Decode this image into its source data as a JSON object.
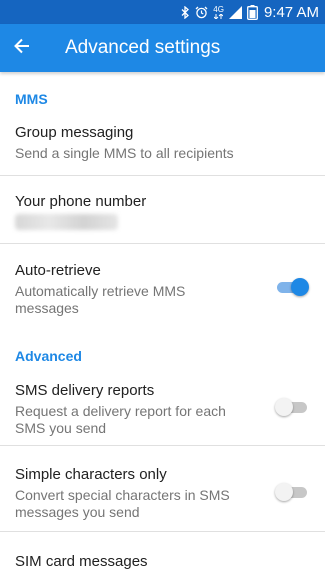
{
  "status_bar": {
    "time": "9:47 AM",
    "network": "4G",
    "icons": [
      "bluetooth-icon",
      "alarm-icon",
      "network-4g-icon",
      "signal-icon",
      "battery-icon"
    ]
  },
  "app_bar": {
    "title": "Advanced settings",
    "back_icon": "arrow-back-icon"
  },
  "sections": {
    "mms": {
      "header": "MMS",
      "group_messaging": {
        "title": "Group messaging",
        "summary": "Send a single MMS to all recipients"
      },
      "phone_number": {
        "title": "Your phone number"
      },
      "auto_retrieve": {
        "title": "Auto-retrieve",
        "summary_line1": "Automatically retrieve MMS",
        "summary_line2": "messages",
        "enabled": true
      }
    },
    "advanced": {
      "header": "Advanced",
      "delivery_reports": {
        "title": "SMS delivery reports",
        "summary_line1": "Request a delivery report for each",
        "summary_line2": "SMS you send",
        "enabled": false
      },
      "simple_chars": {
        "title": "Simple characters only",
        "summary_line1": "Convert special characters in SMS",
        "summary_line2": "messages you send",
        "enabled": false
      },
      "sim_messages": {
        "title": "SIM card messages"
      }
    }
  },
  "colors": {
    "status_bar": "#1565c0",
    "app_bar": "#1e88e5",
    "accent": "#1e88e5",
    "switch_off_track": "#c7c7c7"
  }
}
